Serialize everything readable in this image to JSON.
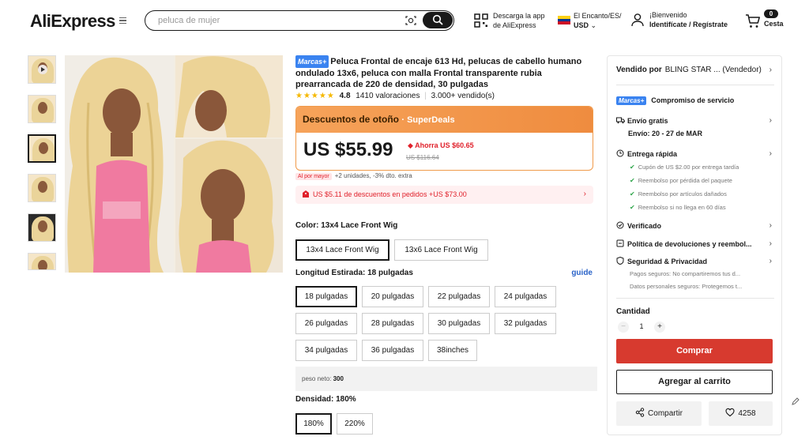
{
  "header": {
    "logo": "AliExpress",
    "search_placeholder": "peluca de mujer",
    "app_line1": "Descarga la app",
    "app_line2": "de AliExpress",
    "locale_line1": "El Encanto/ES/",
    "locale_line2": "USD",
    "user_line1": "¡Bienvenido",
    "user_line2": "Identifícate / Regístrate",
    "cart_count": "0",
    "cart_label": "Cesta"
  },
  "product": {
    "brand_badge": "Marcas+",
    "title": "Peluca Frontal de encaje 613 Hd, pelucas de cabello humano ondulado 13x6, peluca con malla Frontal transparente rubia prearrancada de 220 de densidad, 30 pulgadas",
    "stars": "★★★★★",
    "rating": "4.8",
    "reviews": "1410 valoraciones",
    "sold": "3.000+ vendido(s)",
    "deal_name": "Descuentos de otoño",
    "deal_sub": "· SuperDeals",
    "price": "US $55.99",
    "saving": "Ahorra US $60.65",
    "original_price": "US $116.64",
    "bulk_tag": "Al por mayor",
    "bulk_text": "+2 unidades, -3% dto. extra",
    "coupon_text": "US $5.11 de descuentos en pedidos +US $73.00",
    "color_label": "Color:",
    "color_value": "13x4 Lace Front Wig",
    "color_options": [
      "13x4 Lace Front Wig",
      "13x6 Lace Front Wig"
    ],
    "length_label": "Longitud Estirada:",
    "length_value": "18 pulgadas",
    "guide": "guide",
    "length_options": [
      "18 pulgadas",
      "20 pulgadas",
      "22 pulgadas",
      "24 pulgadas",
      "26 pulgadas",
      "28 pulgadas",
      "30 pulgadas",
      "32 pulgadas",
      "34 pulgadas",
      "36 pulgadas",
      "38inches"
    ],
    "weight_label": "peso neto:",
    "weight_value": "300",
    "density_label": "Densidad:",
    "density_value": "180%",
    "density_options": [
      "180%",
      "220%"
    ]
  },
  "panel": {
    "sold_by_label": "Vendido por",
    "seller_name": "BLING STAR ...",
    "seller_role": "(Vendedor)",
    "brand_badge": "Marcas+",
    "commitment": "Compromiso de servicio",
    "shipping_title": "Envío gratis",
    "shipping_dates": "Envío: 20 - 27 de MAR",
    "fast_delivery": "Entrega rápida",
    "fast_items": [
      "Cupón de US $2.00 por entrega tardía",
      "Reembolso por pérdida del paquete",
      "Reembolso por artículos dañados",
      "Reembolso si no llega en 60 días"
    ],
    "verified": "Verificado",
    "returns": "Política de devoluciones y reembol...",
    "security": "Seguridad & Privacidad",
    "security_items": [
      "Pagos seguros: No compartiremos tus d...",
      "Datos personales seguros: Protegemos t..."
    ],
    "qty_label": "Cantidad",
    "qty_value": "1",
    "buy": "Comprar",
    "add_cart": "Agregar al carrito",
    "share": "Compartir",
    "likes": "4258"
  },
  "colors": {
    "accent_red": "#d73a2f",
    "deal_orange": "#ef8c3f",
    "brand_blue": "#3a83f0",
    "star_yellow": "#f5b800",
    "link_blue": "#2a63c8"
  }
}
